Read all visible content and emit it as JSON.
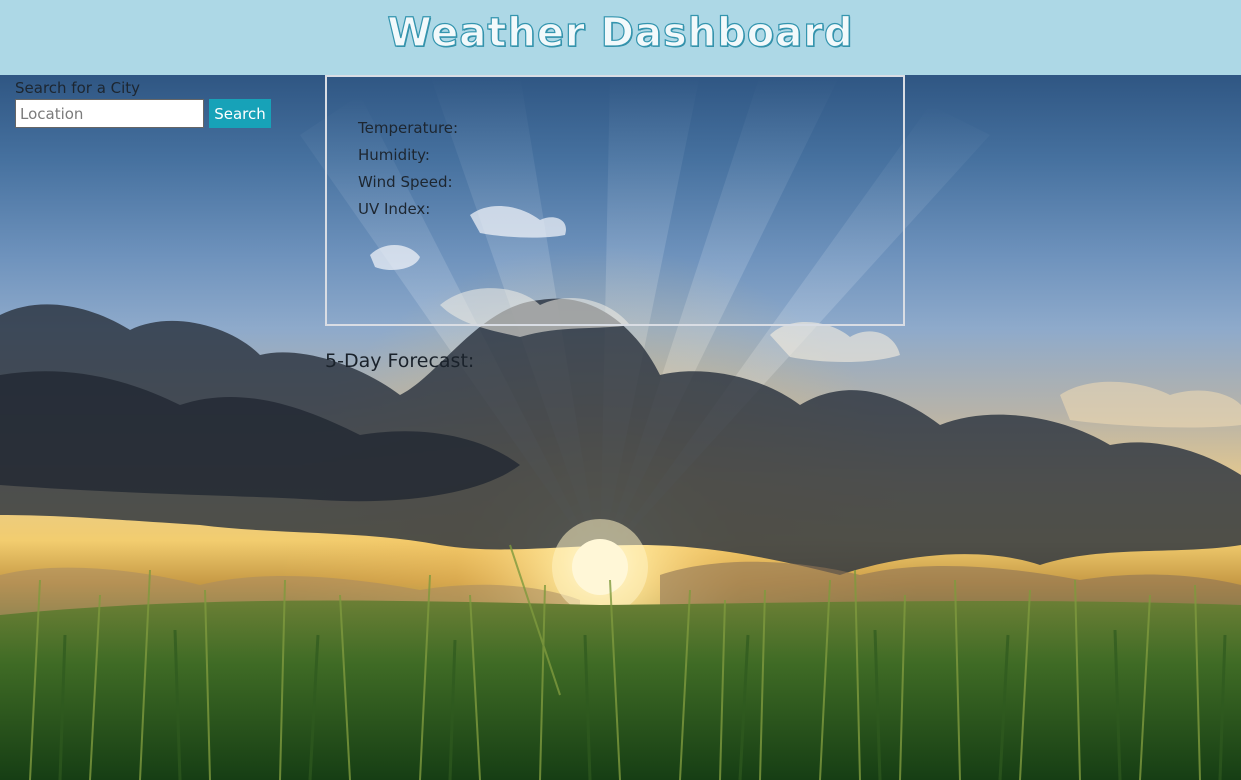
{
  "header": {
    "title": "Weather Dashboard"
  },
  "search": {
    "label": "Search for a City",
    "placeholder": "Location",
    "value": "",
    "button_label": "Search"
  },
  "current_weather": {
    "temperature_label": "Temperature:",
    "humidity_label": "Humidity:",
    "wind_speed_label": "Wind Speed:",
    "uv_index_label": "UV Index:"
  },
  "forecast": {
    "title": "5-Day Forecast:"
  },
  "colors": {
    "header_bg": "#add8e6",
    "title_outline": "#1f8aa6",
    "search_button_bg": "#17a2b8",
    "box_border": "#d9dde4"
  },
  "background": {
    "scene": "sunset-sky-grass-field"
  }
}
